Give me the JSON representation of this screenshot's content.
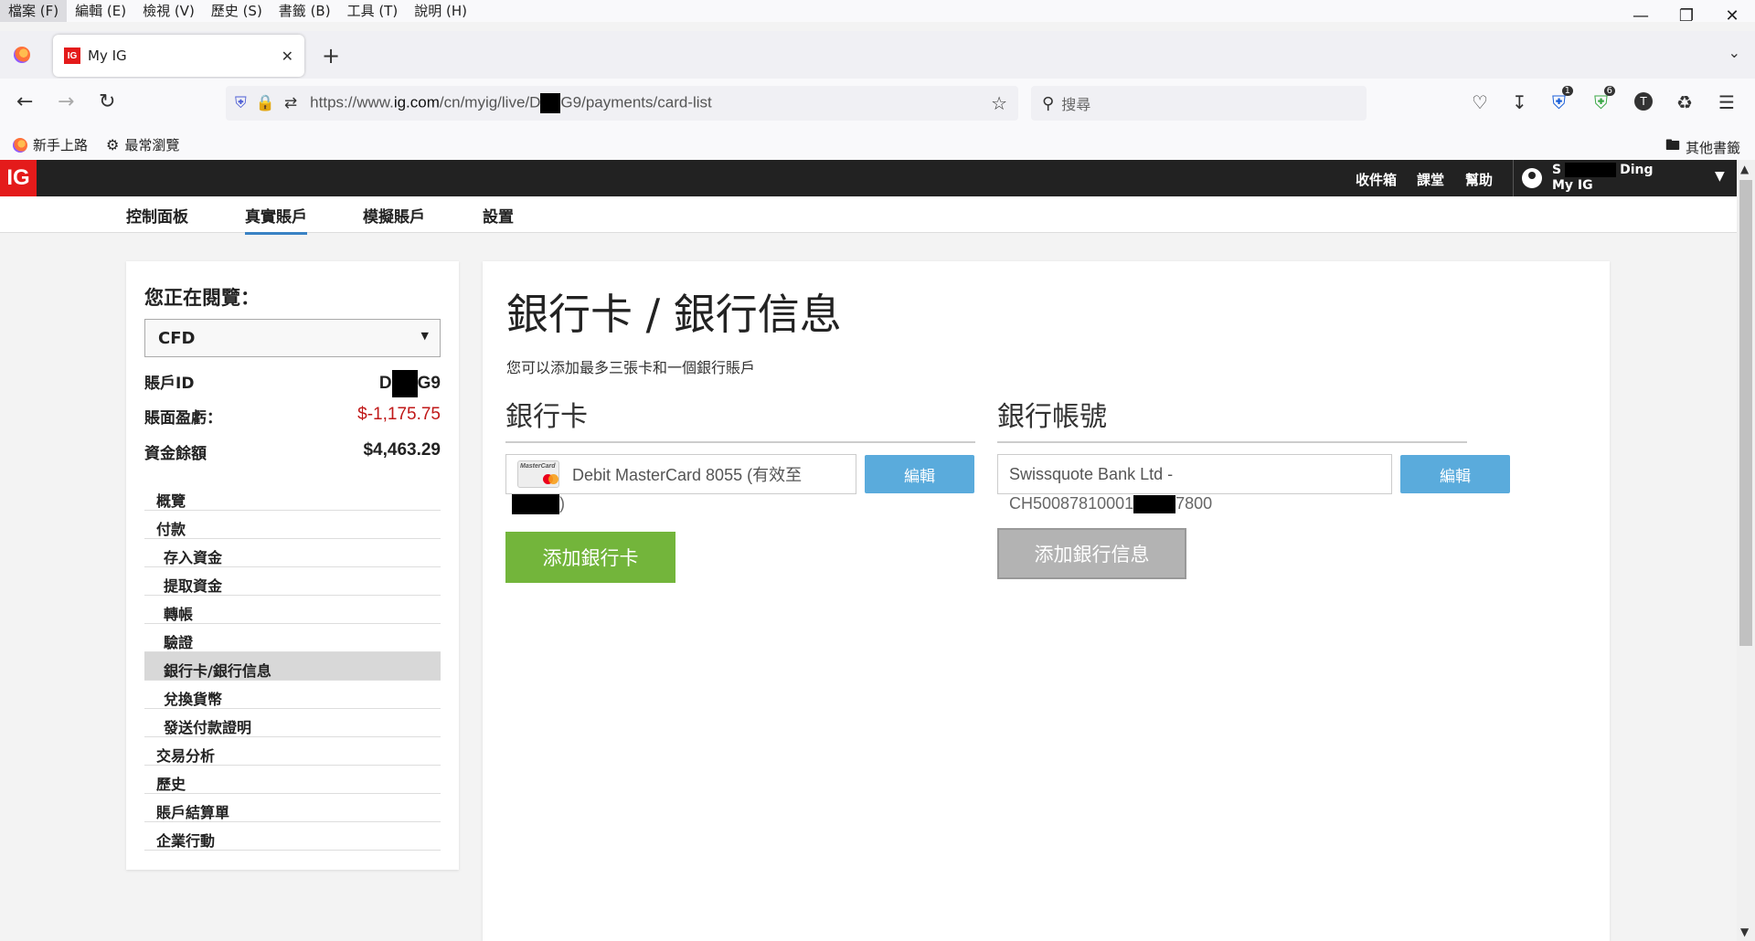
{
  "browser": {
    "menu": [
      "檔案 (F)",
      "編輯 (E)",
      "檢視 (V)",
      "歷史 (S)",
      "書籤 (B)",
      "工具 (T)",
      "說明 (H)"
    ],
    "tab_title": "My IG",
    "tab_favicon": "IG",
    "url_prefix": "https://www.",
    "url_domain": "ig.com",
    "url_mid": "/cn/myig/live/D",
    "url_suffix": "G9/payments/card-list",
    "search_placeholder": "搜尋",
    "badge_1": "1",
    "badge_6": "6",
    "profile_letter": "T",
    "bookmarks": [
      "新手上路",
      "最常瀏覽"
    ],
    "other_bookmarks": "其他書籤"
  },
  "header": {
    "logo": "IG",
    "links": [
      "收件箱",
      "課堂",
      "幫助"
    ],
    "user_first": "S",
    "user_last": "Ding",
    "user_sub": "My IG"
  },
  "subnav": [
    "控制面板",
    "真實賬戶",
    "模擬賬戶",
    "設置"
  ],
  "sidebar": {
    "title": "您正在閱覽：",
    "account_type": "CFD",
    "account_id_label": "賬戶ID",
    "account_id_start": "D",
    "account_id_end": "G9",
    "pnl_label": "賬面盈虧：",
    "pnl_value": "$-1,175.75",
    "balance_label": "資金餘額",
    "balance_value": "$4,463.29",
    "menu": [
      {
        "label": "概覽",
        "sub": false
      },
      {
        "label": "付款",
        "sub": false
      },
      {
        "label": "存入資金",
        "sub": true
      },
      {
        "label": "提取資金",
        "sub": true
      },
      {
        "label": "轉帳",
        "sub": true
      },
      {
        "label": "驗證",
        "sub": true
      },
      {
        "label": "銀行卡/銀行信息",
        "sub": true,
        "active": true
      },
      {
        "label": "兌換貨幣",
        "sub": true
      },
      {
        "label": "發送付款證明",
        "sub": true
      },
      {
        "label": "交易分析",
        "sub": false
      },
      {
        "label": "歷史",
        "sub": false
      },
      {
        "label": "賬戶結算單",
        "sub": false
      },
      {
        "label": "企業行動",
        "sub": false
      }
    ]
  },
  "main": {
    "title": "銀行卡 / 銀行信息",
    "description": "您可以添加最多三張卡和一個銀行賬戶",
    "card_section": {
      "title": "銀行卡",
      "card_logo": "MasterCard",
      "card_text": "Debit MasterCard 8055 (有效至",
      "card_text_tail": ")",
      "edit_label": "編輯",
      "add_label": "添加銀行卡"
    },
    "bank_section": {
      "title": "銀行帳號",
      "bank_name": "Swissquote Bank Ltd -",
      "iban_start": "CH50087810001",
      "iban_end": "7800",
      "edit_label": "編輯",
      "add_label": "添加銀行信息"
    }
  }
}
